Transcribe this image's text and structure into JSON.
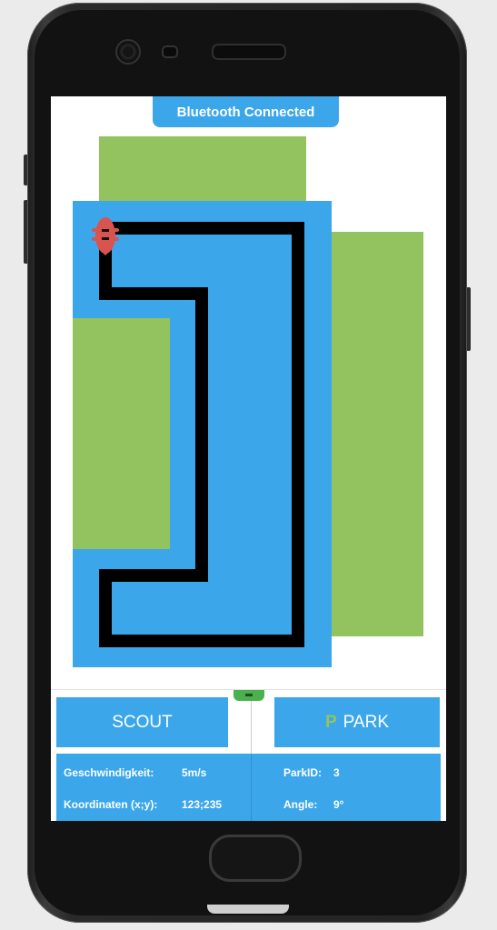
{
  "banner": {
    "status": "Bluetooth Connected"
  },
  "colors": {
    "accent": "#3ba7ea",
    "parking": "#93c35f",
    "path": "#000000",
    "car": "#d9534f"
  },
  "map": {
    "car_icon": "robot-car-icon"
  },
  "controls": {
    "scout_label": "SCOUT",
    "park_icon": "P",
    "park_label": "PARK"
  },
  "info": {
    "speed_label": "Geschwindigkeit:",
    "speed_value": "5m/s",
    "coords_label": "Koordinaten (x;y):",
    "coords_value": "123;235",
    "parkid_label": "ParkID:",
    "parkid_value": "3",
    "angle_label": "Angle:",
    "angle_value": "9°"
  }
}
